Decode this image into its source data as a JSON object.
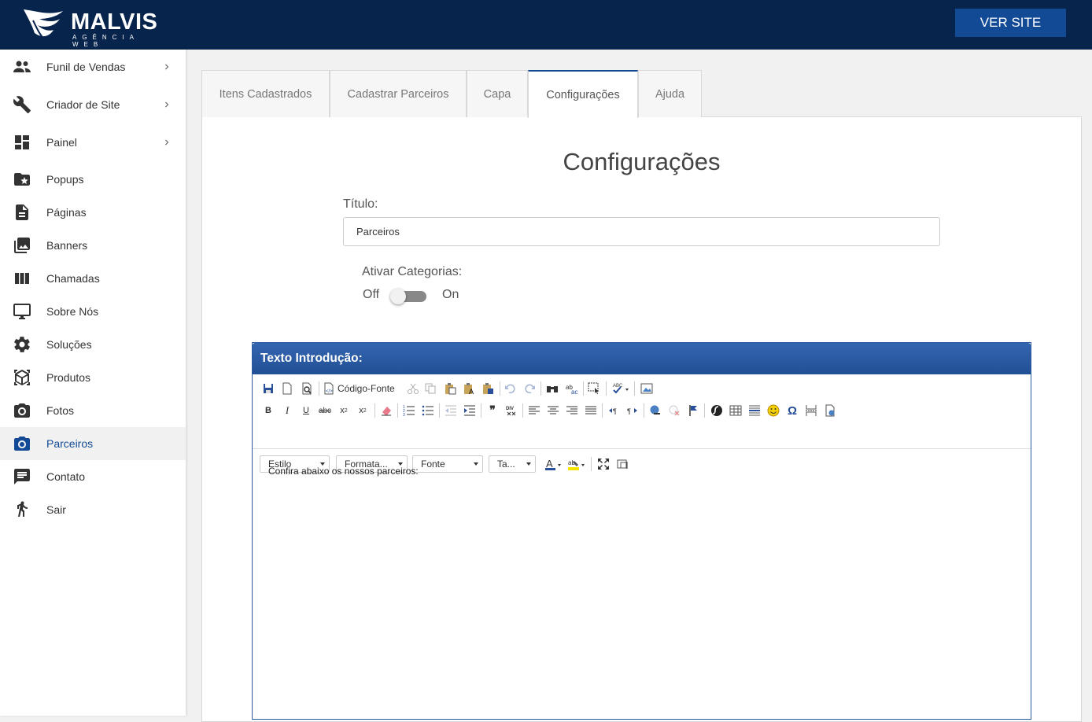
{
  "header": {
    "logo_text": "MALVIS",
    "logo_subtext": "AGÊNCIA WEB",
    "ver_site_label": "VER SITE"
  },
  "sidebar": {
    "items": [
      {
        "label": "Funil de Vendas",
        "icon": "people-icon",
        "has_chevron": true
      },
      {
        "label": "Criador de Site",
        "icon": "wrench-icon",
        "has_chevron": true
      },
      {
        "label": "Painel",
        "icon": "dashboard-icon",
        "has_chevron": true
      },
      {
        "label": "Popups",
        "icon": "folder-star-icon"
      },
      {
        "label": "Páginas",
        "icon": "document-icon"
      },
      {
        "label": "Banners",
        "icon": "photo-library-icon"
      },
      {
        "label": "Chamadas",
        "icon": "columns-icon"
      },
      {
        "label": "Sobre Nós",
        "icon": "monitor-icon"
      },
      {
        "label": "Soluções",
        "icon": "gear-icon"
      },
      {
        "label": "Produtos",
        "icon": "box-icon"
      },
      {
        "label": "Fotos",
        "icon": "camera-icon"
      },
      {
        "label": "Parceiros",
        "icon": "camera-icon",
        "active": true
      },
      {
        "label": "Contato",
        "icon": "chat-icon"
      },
      {
        "label": "Sair",
        "icon": "walk-icon"
      }
    ]
  },
  "tabs": [
    {
      "label": "Itens Cadastrados"
    },
    {
      "label": "Cadastrar Parceiros"
    },
    {
      "label": "Capa"
    },
    {
      "label": "Configurações",
      "active": true
    },
    {
      "label": "Ajuda"
    }
  ],
  "form": {
    "title": "Configurações",
    "titulo_label": "Título:",
    "titulo_value": "Parceiros",
    "categorias_label": "Ativar Categorias:",
    "toggle_off_label": "Off",
    "toggle_on_label": "On",
    "categorias_enabled": false
  },
  "editor": {
    "heading": "Texto Introdução:",
    "source_label": "Código-Fonte",
    "combos": {
      "style": "Estilo",
      "format": "Formata...",
      "font": "Fonte",
      "size": "Ta..."
    },
    "content": "Confira abaixo os nossos parceiros:"
  },
  "colors": {
    "header_bg": "#06244c",
    "accent": "#124a96",
    "editor_header": "#2c5aa0"
  }
}
